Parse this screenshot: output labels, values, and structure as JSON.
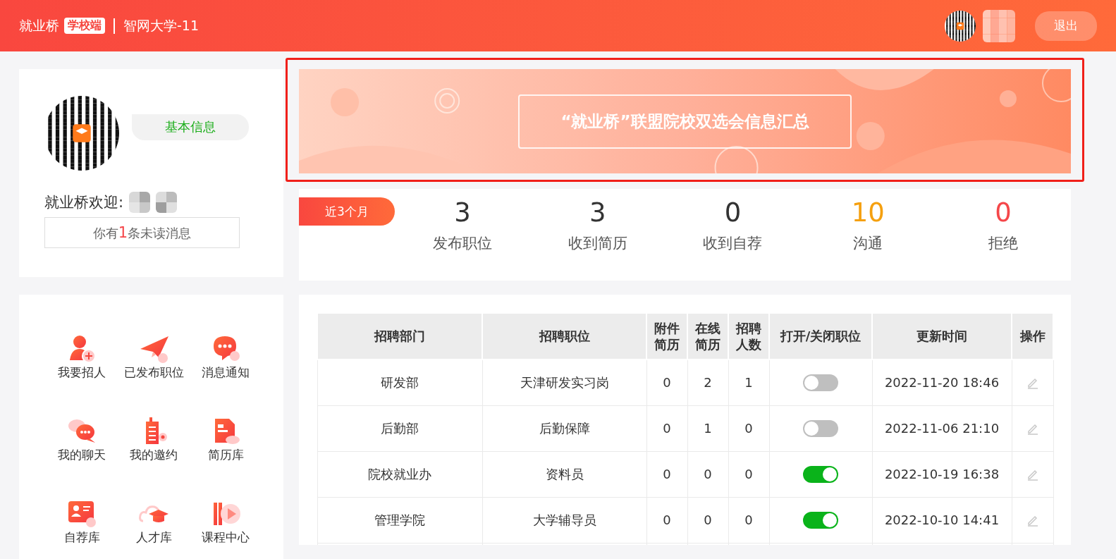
{
  "header": {
    "brand": "就业桥",
    "badge": "学校端",
    "school": "智网大学-11",
    "logout": "退出"
  },
  "profile": {
    "info_button": "基本信息",
    "welcome": "就业桥欢迎:",
    "message": "你有**1**条未读消息"
  },
  "menu": [
    {
      "label": "我要招人"
    },
    {
      "label": "已发布职位"
    },
    {
      "label": "消息通知"
    },
    {
      "label": "我的聊天"
    },
    {
      "label": "我的邀约"
    },
    {
      "label": "简历库"
    },
    {
      "label": "自荐库"
    },
    {
      "label": "人才库"
    },
    {
      "label": "课程中心"
    }
  ],
  "banner": {
    "title": "“就业桥”联盟院校双选会信息汇总"
  },
  "stats": {
    "period": "近3个月",
    "items": [
      {
        "value": "3",
        "label": "发布职位",
        "color": "#333333"
      },
      {
        "value": "3",
        "label": "收到简历",
        "color": "#333333"
      },
      {
        "value": "0",
        "label": "收到自荐",
        "color": "#333333"
      },
      {
        "value": "10",
        "label": "沟通",
        "color": "#f5a00f"
      },
      {
        "value": "0",
        "label": "拒绝",
        "color": "#f5474a"
      }
    ]
  },
  "table": {
    "columns": [
      "招聘部门",
      "招聘职位",
      "附件简历",
      "在线简历",
      "招聘人数",
      "打开/关闭职位",
      "更新时间",
      "操作"
    ],
    "rows": [
      {
        "department": "研发部",
        "position": "天津研发实习岗",
        "attachments": "0",
        "online": "2",
        "headcount": "1",
        "on": false,
        "updated": "2022-11-20 18:46"
      },
      {
        "department": "后勤部",
        "position": "后勤保障",
        "attachments": "0",
        "online": "1",
        "headcount": "0",
        "on": false,
        "updated": "2022-11-06 21:10"
      },
      {
        "department": "院校就业办",
        "position": "资料员",
        "attachments": "0",
        "online": "0",
        "headcount": "0",
        "on": true,
        "updated": "2022-10-19 16:38"
      },
      {
        "department": "管理学院",
        "position": "大学辅导员",
        "attachments": "0",
        "online": "0",
        "headcount": "0",
        "on": true,
        "updated": "2022-10-10 14:41"
      }
    ]
  }
}
